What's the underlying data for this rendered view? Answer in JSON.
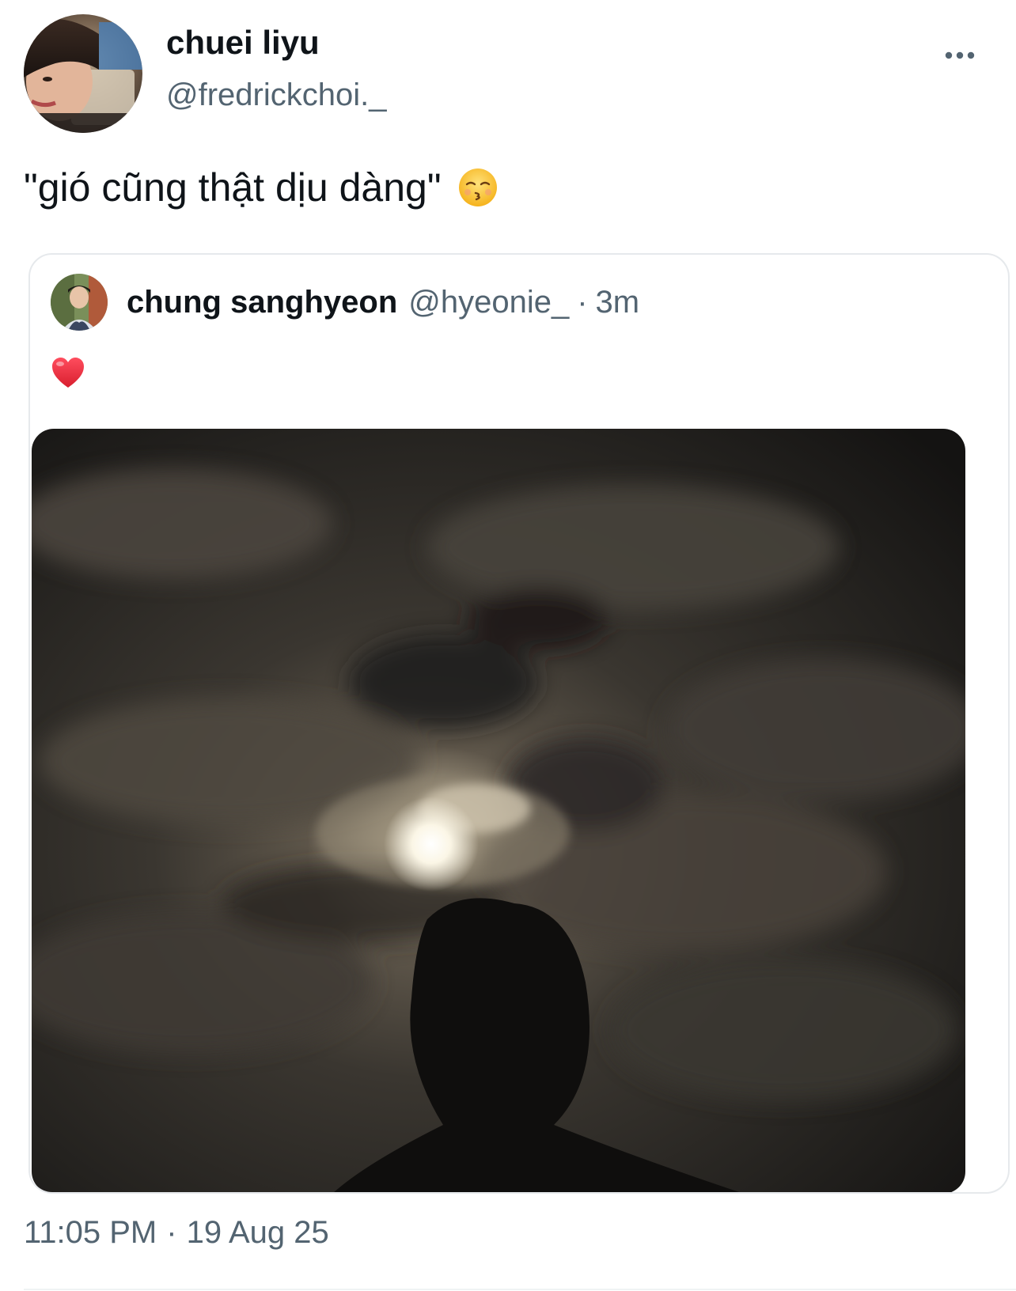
{
  "tweet": {
    "author": {
      "display_name": "chuei liyu",
      "handle": "@fredrickchoi._",
      "avatar_icon": "profile-photo"
    },
    "more_icon": "more-horizontal-icon",
    "text": "\"gió cũng thật dịu dàng\"",
    "emoji": "kissing-face-with-closed-eyes",
    "timestamp": {
      "time": "11:05 PM",
      "separator": "·",
      "date": "19 Aug 25"
    }
  },
  "quote": {
    "display_name": "chung sanghyeon",
    "handle": "@hyeonie_",
    "separator": "·",
    "time": "3m",
    "text_emoji": "red-heart",
    "media": "night-sky-moon-clouds-silhouette-photo"
  },
  "colors": {
    "text_primary": "#0f1419",
    "text_secondary": "#536471",
    "border": "#e6e9ec",
    "heart": "#e0245e"
  }
}
